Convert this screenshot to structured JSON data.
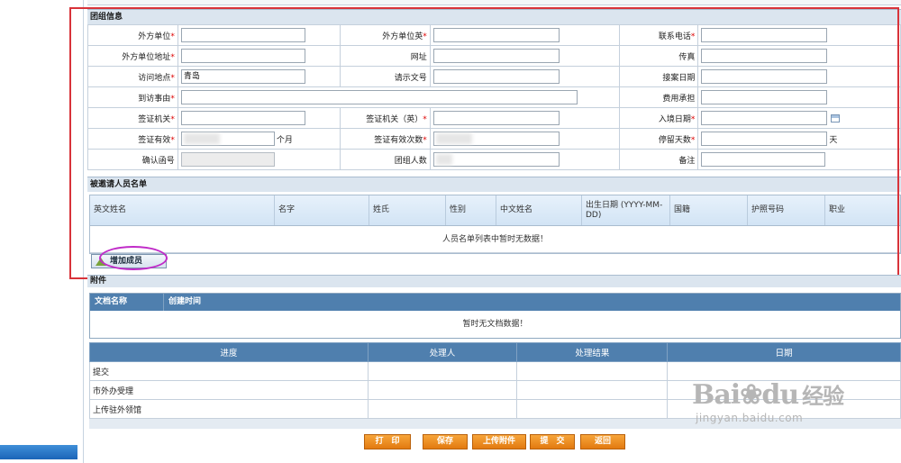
{
  "group_info": {
    "title": "团组信息",
    "rows": [
      [
        {
          "label": "外方单位",
          "required": true,
          "value": ""
        },
        {
          "label": "外方单位英",
          "required": true,
          "value": ""
        },
        {
          "label": "联系电话",
          "required": true,
          "value": ""
        }
      ],
      [
        {
          "label": "外方单位地址",
          "required": true,
          "value": ""
        },
        {
          "label": "网址",
          "required": false,
          "value": ""
        },
        {
          "label": "传真",
          "required": false,
          "value": ""
        }
      ],
      [
        {
          "label": "访问地点",
          "required": true,
          "value": "青岛"
        },
        {
          "label": "请示文号",
          "required": false,
          "value": ""
        },
        {
          "label": "接案日期",
          "required": false,
          "value": ""
        }
      ],
      [
        {
          "label": "到访事由",
          "required": true,
          "value": ""
        },
        {
          "label": "费用承担",
          "required": false,
          "value": ""
        }
      ],
      [
        {
          "label": "签证机关",
          "required": true,
          "value": ""
        },
        {
          "label": "签证机关（英）",
          "required": true,
          "value": ""
        },
        {
          "label": "入境日期",
          "required": true,
          "value": ""
        }
      ],
      [
        {
          "label": "签证有效",
          "required": true,
          "value": "",
          "unit": "个月"
        },
        {
          "label": "签证有效次数",
          "required": true,
          "value": ""
        },
        {
          "label": "停留天数",
          "required": true,
          "value": "",
          "unit": "天"
        }
      ],
      [
        {
          "label": "确认函号",
          "required": false,
          "value": ""
        },
        {
          "label": "团组人数",
          "required": false,
          "value": ""
        },
        {
          "label": "备注",
          "required": false,
          "value": ""
        }
      ]
    ]
  },
  "invitees": {
    "title": "被邀请人员名单",
    "columns": [
      "英文姓名",
      "名字",
      "姓氏",
      "性别",
      "中文姓名",
      "出生日期 (YYYY-MM-DD)",
      "国籍",
      "护照号码",
      "职业"
    ],
    "empty_message": "人员名单列表中暂时无数据！",
    "add_button": "增加成员"
  },
  "attachments": {
    "title": "附件",
    "columns": [
      "文档名称",
      "创建时间"
    ],
    "empty_message": "暂时无文档数据！"
  },
  "progress": {
    "columns": [
      "进度",
      "处理人",
      "处理结果",
      "日期"
    ],
    "rows": [
      "提交",
      "市外办受理",
      "上传驻外领馆"
    ]
  },
  "actions": {
    "print": "打　印",
    "save": "保存",
    "upload": "上传附件",
    "submit": "提　交",
    "back": "返回"
  },
  "watermark": {
    "brand": "Bai",
    "brand_cn": "经验",
    "url": "jingyan.baidu.com"
  },
  "colors": {
    "highlight_box": "#d8333a",
    "circle_mark": "#c02bc8",
    "header_blue": "#4f7fae",
    "action_orange": "#e27a10"
  }
}
